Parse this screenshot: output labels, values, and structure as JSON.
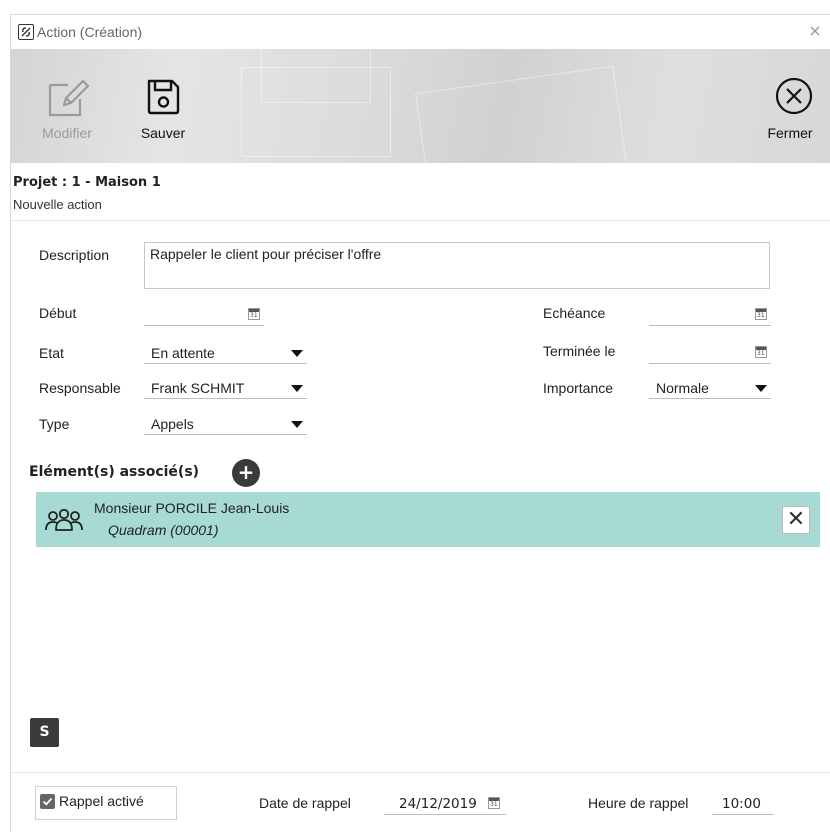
{
  "window": {
    "title": "Action (Création)",
    "close_glyph": "×"
  },
  "toolbar": {
    "modifier_label": "Modifier",
    "sauver_label": "Sauver",
    "fermer_label": "Fermer",
    "icons": {
      "modifier": "edit-pencil-icon",
      "sauver": "save-floppy-icon",
      "fermer": "close-circle-icon"
    }
  },
  "project": {
    "title": "Projet : 1 - Maison 1",
    "subtitle": "Nouvelle action"
  },
  "form": {
    "description_label": "Description",
    "description_value": "Rappeler le client pour préciser l'offre",
    "debut_label": "Début",
    "debut_value": "",
    "echeance_label": "Echéance",
    "echeance_value": "",
    "etat_label": "Etat",
    "etat_value": "En attente",
    "terminee_label": "Terminée le",
    "terminee_value": "",
    "responsable_label": "Responsable",
    "responsable_value": "Frank SCHMIT",
    "importance_label": "Importance",
    "importance_value": "Normale",
    "type_label": "Type",
    "type_value": "Appels",
    "calendar_icon_text": "31"
  },
  "associated": {
    "title": "Elément(s) associé(s)",
    "add_glyph": "+",
    "items": [
      {
        "name": "Monsieur PORCILE Jean-Louis",
        "company": "Quadram (00001)",
        "icon": "group-people-icon",
        "remove_glyph": "✕"
      }
    ]
  },
  "badge": {
    "s_label": "S"
  },
  "footer": {
    "rappel_label": "Rappel activé",
    "rappel_checked": true,
    "date_rappel_label": "Date de rappel",
    "date_rappel_value": "24/12/2019",
    "heure_rappel_label": "Heure de rappel",
    "heure_rappel_value": "10:00"
  },
  "colors": {
    "assoc_row_bg": "#a7dad3",
    "dark_button": "#3a3a3a",
    "disabled_text": "#9a9a9a"
  }
}
